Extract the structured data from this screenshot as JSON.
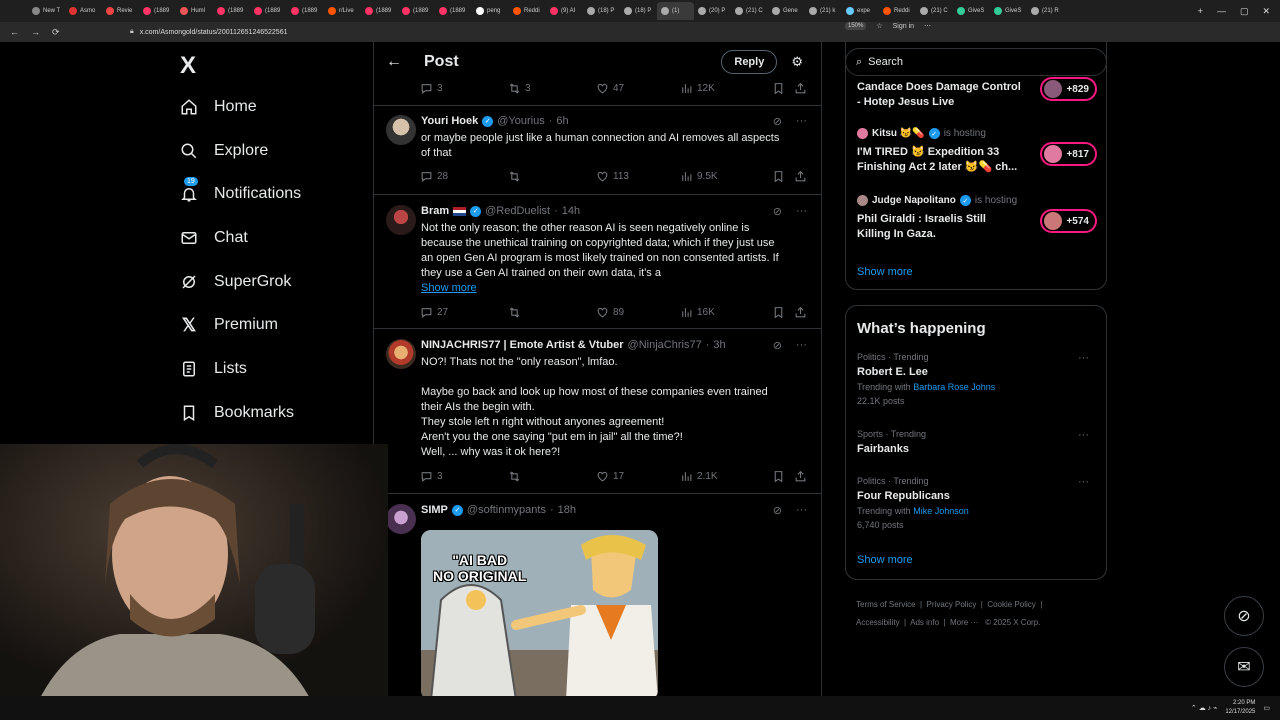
{
  "browser": {
    "tabs": [
      "New T",
      "Asmo",
      "Revie",
      "(1889",
      "Huml",
      "(1889",
      "(1889",
      "(1889",
      "r/Live",
      "(1889",
      "(1889",
      "(1889",
      "peng",
      "Reddi",
      "(9) AI",
      "(18) P",
      "(18) P",
      "(1)",
      "(20) P",
      "(21) C",
      "Gene",
      "(21) k",
      "expe",
      "Reddi",
      "(21) C",
      "GiveS",
      "GiveS",
      "(21) R"
    ],
    "active_tab_index": 17,
    "url": "x.com/Asmongold/status/2001126512465225​61",
    "zoom": "150%",
    "profile": "Sign in"
  },
  "nav": {
    "logo": "X",
    "items": [
      {
        "label": "Home",
        "icon": "home-icon"
      },
      {
        "label": "Explore",
        "icon": "search-icon"
      },
      {
        "label": "Notifications",
        "icon": "bell-icon",
        "badge": "19"
      },
      {
        "label": "Chat",
        "icon": "mail-icon"
      },
      {
        "label": "SuperGrok",
        "icon": "grok-icon"
      },
      {
        "label": "Premium",
        "icon": "x-icon"
      },
      {
        "label": "Lists",
        "icon": "list-icon"
      },
      {
        "label": "Bookmarks",
        "icon": "bookmark-icon"
      }
    ]
  },
  "post_header": {
    "title": "Post",
    "reply_label": "Reply"
  },
  "top_actions": {
    "replies": "3",
    "reposts": "3",
    "likes": "47",
    "views": "12K"
  },
  "tweets": [
    {
      "name": "Youri Hoek",
      "handle": "@Yourius",
      "time": "6h",
      "text": "or maybe people just like a human connection and AI removes all aspects\nof that",
      "replies": "28",
      "reposts": "",
      "likes": "113",
      "views": "9.5K"
    },
    {
      "name": "Bram",
      "handle": "@RedDuelist",
      "time": "14h",
      "text": "Not the only reason; the other reason AI is seen negatively online is\nbecause the unethical training on copyrighted data; which if they just use\nan open Gen AI program is most likely trained on non consented artists. If\nthey use a Gen AI trained on their own data, it's a",
      "show_more": "Show more",
      "replies": "27",
      "reposts": "",
      "likes": "89",
      "views": "16K"
    },
    {
      "name": "NINJACHRIS77 | Emote Artist & Vtuber",
      "handle": "@NinjaChris77",
      "time": "3h",
      "text": "NO?! Thats not the \"only reason\", lmfao.\n\nMaybe go back and look up how most of these companies even trained\ntheir AIs the begin with.\nThey stole left n right without anyones agreement!\nAren't you the one saying \"put em in jail\" all the time?!\nWell, ... why was it ok here?!",
      "replies": "3",
      "reposts": "",
      "likes": "17",
      "views": "2.1K"
    },
    {
      "name": "SIMP",
      "handle": "@softinmypants",
      "time": "18h",
      "meme_caption": "\"AI BAD\nNO ORIGINAL"
    }
  ],
  "sidebar": {
    "search_placeholder": "Search",
    "live": [
      {
        "host": "",
        "status": "",
        "title": "Candace Does Damage Control\n- Hotep Jesus Live",
        "count": "+829"
      },
      {
        "host": "Kitsu 😼💊",
        "status": "is hosting",
        "title": "I'M TIRED 😼 Expedition 33\nFinishing Act 2 later 😼💊 ch...",
        "count": "+817"
      },
      {
        "host": "Judge Napolitano",
        "status": "is hosting",
        "title": "Phil Giraldi : Israelis Still\nKilling In Gaza.",
        "count": "+574"
      }
    ],
    "show_more": "Show more",
    "happening_title": "What’s happening",
    "trends": [
      {
        "category": "Politics · Trending",
        "name": "Robert E. Lee",
        "sub_prefix": "Trending with",
        "sub_link": "Barbara Rose Johns",
        "posts": "22.1K posts"
      },
      {
        "category": "Sports · Trending",
        "name": "Fairbanks",
        "sub_prefix": "",
        "sub_link": "",
        "posts": ""
      },
      {
        "category": "Politics · Trending",
        "name": "Four Republicans",
        "sub_prefix": "Trending with",
        "sub_link": "Mike Johnson",
        "posts": "6,740 posts"
      }
    ],
    "footer": {
      "terms": "Terms of Service",
      "privacy": "Privacy Policy",
      "cookie": "Cookie Policy",
      "accessibility": "Accessibility",
      "ads": "Ads info",
      "more": "More ···",
      "copyright": "© 2025 X Corp."
    }
  },
  "taskbar": {
    "time": "2:20 PM",
    "date": "12/17/2025"
  },
  "colors": {
    "accent": "#1d9bf0",
    "live": "#f91880",
    "border": "#2f3336",
    "muted": "#71767b"
  }
}
